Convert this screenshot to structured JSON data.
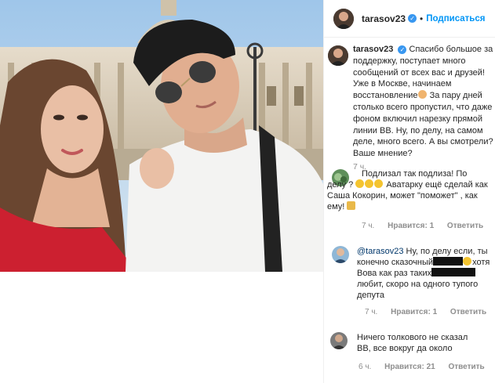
{
  "post": {
    "username": "tarasov23",
    "separator": "•",
    "follow_label": "Подписаться"
  },
  "caption": {
    "username": "tarasov23",
    "text_before_emoji": "Спасибо большое за поддержку, поступает много сообщений от всех вас и друзей! Уже в Москве, начинаем восстановление",
    "text_after_emoji": " За пару дней столько всего пропустил, что даже фоном включил нарезку прямой линии ВВ. Ну, по делу, на самом деле, много всего. А вы смотрели? Ваше мнение?",
    "time": "7 ч."
  },
  "comments": [
    {
      "text_1": "Подлизал так подлиза! По делу ? ",
      "text_2": " Аватарку ещё сделай как Саша Кокорин, может \"поможет\" , как ему! ",
      "time": "7 ч.",
      "likes": "Нравится: 1",
      "reply": "Ответить"
    },
    {
      "mention": "@tarasov23",
      "text_1": " Ну, по делу если, ты конечно сказочный",
      "text_2": "хотя Вова как раз таких",
      "text_3": "любит, скоро на одного тупого депута",
      "time": "7 ч.",
      "likes": "Нравится: 1",
      "reply": "Ответить"
    },
    {
      "text_1": "Ничего толкового не сказал ВВ, все вокруг да около",
      "time": "6 ч.",
      "likes": "Нравится: 21",
      "reply": "Ответить"
    }
  ],
  "icons": {
    "verified": "verified-badge-icon",
    "emoji_flex": "flexed-biceps-emoji",
    "emoji_laugh": "grinning-squinting-emoji",
    "emoji_thumbs": "thumbs-down-emoji"
  },
  "colors": {
    "link_blue": "#0095f6",
    "verified_blue": "#3897f0",
    "meta_gray": "#8e8e8e",
    "mention_blue": "#00376b"
  }
}
